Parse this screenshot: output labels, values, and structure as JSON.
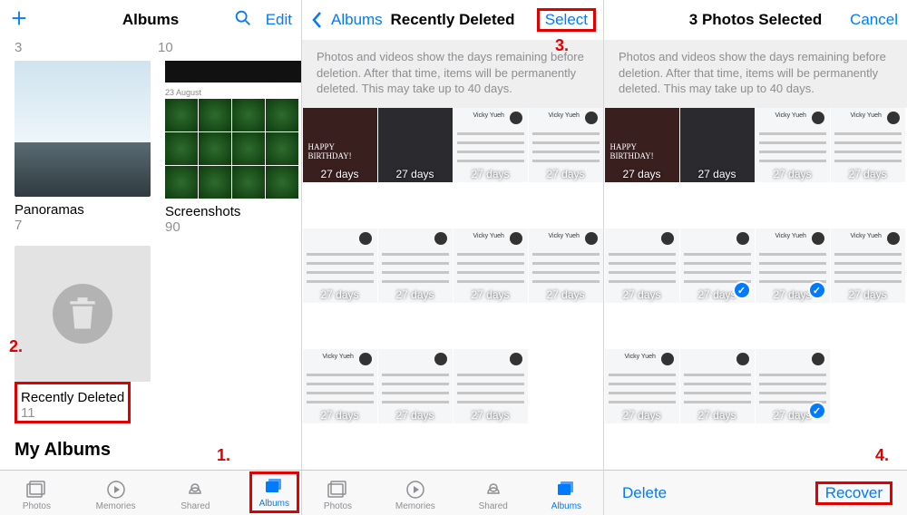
{
  "p1": {
    "nav": {
      "title": "Albums",
      "edit": "Edit"
    },
    "top_counts": {
      "c1": "3",
      "c2": "10"
    },
    "panoramas": {
      "label": "Panoramas",
      "count": "7"
    },
    "screenshots": {
      "label": "Screenshots",
      "count": "90",
      "date": "23 August"
    },
    "recently_deleted": {
      "label": "Recently Deleted",
      "count": "11"
    },
    "my_albums": "My Albums",
    "tabs": {
      "photos": "Photos",
      "memories": "Memories",
      "shared": "Shared",
      "albums": "Albums"
    }
  },
  "p2": {
    "back": "Albums",
    "title": "Recently Deleted",
    "select": "Select",
    "info": "Photos and videos show the days remaining before deletion. After that time, items will be permanently deleted. This may take up to 40 days.",
    "days": "27 days",
    "contact": "Vicky Yueh",
    "tabs": {
      "photos": "Photos",
      "memories": "Memories",
      "shared": "Shared",
      "albums": "Albums"
    }
  },
  "p3": {
    "title": "3 Photos Selected",
    "cancel": "Cancel",
    "info": "Photos and videos show the days remaining before deletion. After that time, items will be permanently deleted. This may take up to 40 days.",
    "days": "27 days",
    "contact": "Vicky Yueh",
    "delete": "Delete",
    "recover": "Recover"
  },
  "anno": {
    "n1": "1.",
    "n2": "2.",
    "n3": "3.",
    "n4": "4."
  }
}
